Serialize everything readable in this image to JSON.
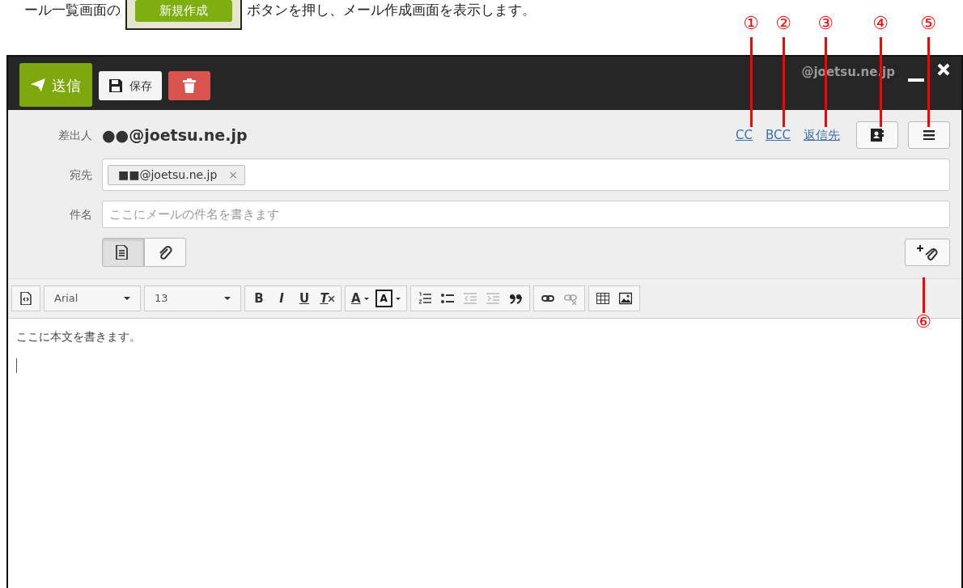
{
  "intro": {
    "before": "ール一覧画面の",
    "button": "新規作成",
    "after": "ボタンを押し、メール作成画面を表示します。"
  },
  "callouts": [
    {
      "label": "①"
    },
    {
      "label": "②"
    },
    {
      "label": "③"
    },
    {
      "label": "④"
    },
    {
      "label": "⑤"
    },
    {
      "label": "⑥"
    }
  ],
  "window": {
    "account": "@joetsu.ne.jp",
    "send": "送信",
    "save": "保存"
  },
  "from": {
    "label": "差出人",
    "value": "●●@joetsu.ne.jp"
  },
  "header_links": [
    "CC",
    "BCC",
    "返信先"
  ],
  "to": {
    "label": "宛先",
    "recipients": [
      {
        "address": "■■@joetsu.ne.jp",
        "remove": "×"
      }
    ]
  },
  "subject": {
    "label": "件名",
    "placeholder": "ここにメールの件名を書きます"
  },
  "mode_tabs": [
    {
      "kind": "text",
      "selected": true
    },
    {
      "kind": "attach",
      "selected": false
    }
  ],
  "toolbar": {
    "font": "Arial",
    "size": "13",
    "bold": "B",
    "italic": "I",
    "underline": "U",
    "clear": "T",
    "text_color_letter": "A",
    "highlight_letter": "A"
  },
  "body": {
    "text": "ここに本文を書きます。"
  }
}
